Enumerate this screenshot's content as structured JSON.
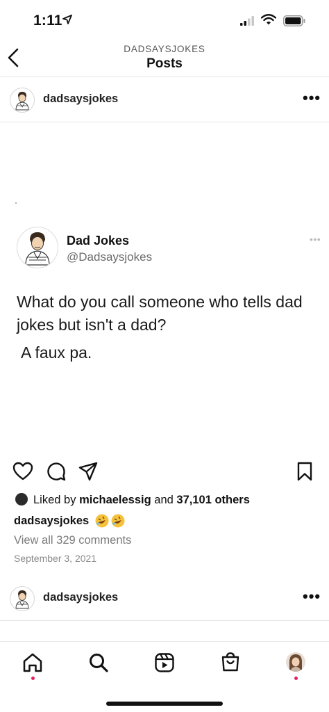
{
  "status_bar": {
    "time": "1:11",
    "icons": [
      "location-arrow-icon",
      "signal-icon",
      "wifi-icon",
      "battery-icon"
    ]
  },
  "header": {
    "account": "DADSAYSJOKES",
    "title": "Posts",
    "back_icon": "chevron-left-icon"
  },
  "post": {
    "username": "dadsaysjokes",
    "more": "•••",
    "tweet": {
      "display_name": "Dad Jokes",
      "handle": "@Dadsaysjokes",
      "more": "•••",
      "text": "What do you call someone who tells dad jokes but isn't a dad?",
      "answer": "A faux pa."
    },
    "actions": [
      "heart-icon",
      "comment-icon",
      "share-icon",
      "bookmark-icon"
    ],
    "likes": {
      "prefix": "Liked by",
      "user": "michaelessig",
      "middle": "and",
      "count": "37,101 others"
    },
    "caption_user": "dadsaysjokes",
    "caption_emoji": [
      "rolling-on-floor-laughing-emoji",
      "rolling-on-floor-laughing-emoji"
    ],
    "view_comments": "View all 329 comments",
    "date": "September 3, 2021"
  },
  "next_post": {
    "username": "dadsaysjokes",
    "more": "•••"
  },
  "bottom_nav": {
    "items": [
      "home-icon",
      "search-icon",
      "reels-icon",
      "shop-icon",
      "profile-avatar"
    ],
    "notification_color": "#e0245e"
  }
}
